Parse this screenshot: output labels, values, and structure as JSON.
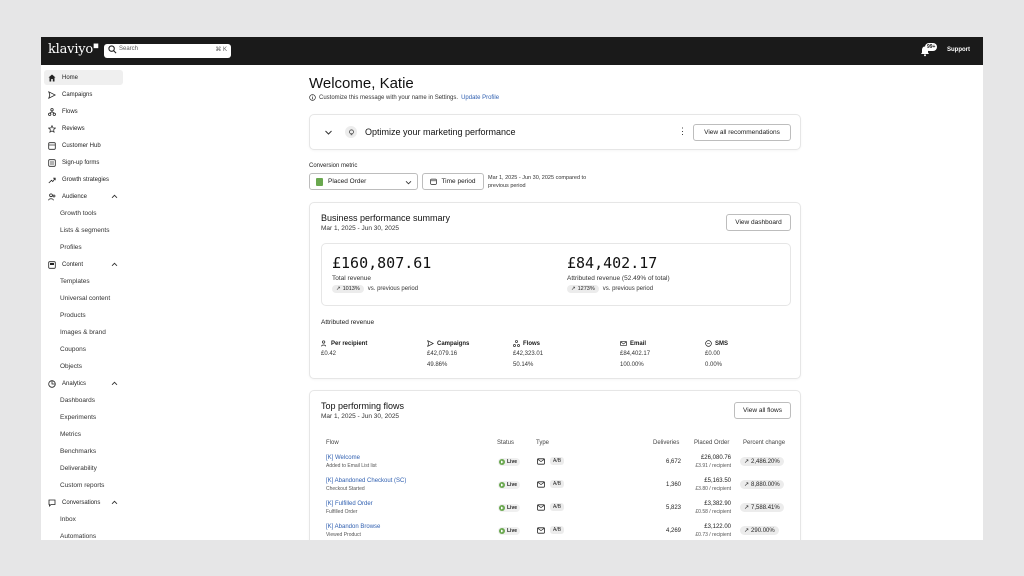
{
  "app": {
    "logo": "klaviyo",
    "search_placeholder": "Search",
    "search_shortcut": "⌘ K",
    "notification_count": "99+",
    "support_label": "Support"
  },
  "sidebar": {
    "items": [
      {
        "label": "Home",
        "icon": "home-icon",
        "active": true
      },
      {
        "label": "Campaigns",
        "icon": "send-icon"
      },
      {
        "label": "Flows",
        "icon": "flows-icon"
      },
      {
        "label": "Reviews",
        "icon": "star-icon"
      },
      {
        "label": "Customer Hub",
        "icon": "hub-icon"
      },
      {
        "label": "Sign-up forms",
        "icon": "form-icon"
      },
      {
        "label": "Growth strategies",
        "icon": "trend-icon"
      },
      {
        "label": "Audience",
        "icon": "people-icon",
        "expanded": true
      },
      {
        "label": "Growth tools",
        "sub": true
      },
      {
        "label": "Lists & segments",
        "sub": true
      },
      {
        "label": "Profiles",
        "sub": true
      },
      {
        "label": "Content",
        "icon": "content-icon",
        "expanded": true
      },
      {
        "label": "Templates",
        "sub": true
      },
      {
        "label": "Universal content",
        "sub": true
      },
      {
        "label": "Products",
        "sub": true
      },
      {
        "label": "Images & brand",
        "sub": true
      },
      {
        "label": "Coupons",
        "sub": true
      },
      {
        "label": "Objects",
        "sub": true
      },
      {
        "label": "Analytics",
        "icon": "analytics-icon",
        "expanded": true
      },
      {
        "label": "Dashboards",
        "sub": true
      },
      {
        "label": "Experiments",
        "sub": true
      },
      {
        "label": "Metrics",
        "sub": true
      },
      {
        "label": "Benchmarks",
        "sub": true
      },
      {
        "label": "Deliverability",
        "sub": true
      },
      {
        "label": "Custom reports",
        "sub": true
      },
      {
        "label": "Conversations",
        "icon": "chat-icon",
        "expanded": true
      },
      {
        "label": "Inbox",
        "sub": true
      },
      {
        "label": "Automations",
        "sub": true
      }
    ]
  },
  "header": {
    "welcome": "Welcome, Katie",
    "customize_text": "Customize this message with your name in Settings.",
    "update_profile": "Update Profile"
  },
  "optimize": {
    "title": "Optimize your marketing performance",
    "button": "View all recommendations"
  },
  "conversion": {
    "label": "Conversion metric",
    "selected": "Placed Order",
    "time_period_button": "Time period",
    "date_range_note_1": "Mar 1, 2025 - Jun 30, 2025 compared to",
    "date_range_note_2": "previous period"
  },
  "business": {
    "title": "Business performance summary",
    "date_range": "Mar 1, 2025 - Jun 30, 2025",
    "button": "View dashboard",
    "total_revenue": "£160,807.61",
    "total_revenue_label": "Total revenue",
    "total_change": "1013%",
    "attributed_revenue": "£84,402.17",
    "attributed_revenue_label": "Attributed revenue (52.49% of total)",
    "attributed_change": "1273%",
    "vs_previous": "vs. previous period",
    "attributed_section_title": "Attributed revenue",
    "attributed_cols": [
      {
        "label": "Per recipient",
        "icon": "recipient-icon",
        "value": "£0.42",
        "pct": ""
      },
      {
        "label": "Campaigns",
        "icon": "send-icon",
        "value": "£42,079.16",
        "pct": "49.86%"
      },
      {
        "label": "Flows",
        "icon": "flows-icon",
        "value": "£42,323.01",
        "pct": "50.14%"
      },
      {
        "label": "Email",
        "icon": "email-icon",
        "value": "£84,402.17",
        "pct": "100.00%"
      },
      {
        "label": "SMS",
        "icon": "sms-icon",
        "value": "£0.00",
        "pct": "0.00%"
      }
    ]
  },
  "flows": {
    "title": "Top performing flows",
    "date_range": "Mar 1, 2025 - Jun 30, 2025",
    "button": "View all flows",
    "columns": [
      "Flow",
      "Status",
      "Type",
      "Deliveries",
      "Placed Order",
      "Percent change"
    ],
    "rows": [
      {
        "name": "[K] Welcome",
        "trigger": "Added to Email List list",
        "status": "Live",
        "type": "A/B",
        "deliveries": "6,672",
        "placed": "£26,080.76",
        "per_recipient": "£3.91 / recipient",
        "change": "2,486.20%"
      },
      {
        "name": "[K] Abandoned Checkout (SC)",
        "trigger": "Checkout Started",
        "status": "Live",
        "type": "A/B",
        "deliveries": "1,360",
        "placed": "£5,163.50",
        "per_recipient": "£3.80 / recipient",
        "change": "8,880.00%"
      },
      {
        "name": "[K] Fulfilled Order",
        "trigger": "Fulfilled Order",
        "status": "Live",
        "type": "A/B",
        "deliveries": "5,823",
        "placed": "£3,382.90",
        "per_recipient": "£0.58 / recipient",
        "change": "7,588.41%"
      },
      {
        "name": "[K] Abandon Browse",
        "trigger": "Viewed Product",
        "status": "Live",
        "type": "A/B",
        "deliveries": "4,269",
        "placed": "£3,122.00",
        "per_recipient": "£0.73 / recipient",
        "change": "290.00%"
      }
    ]
  }
}
